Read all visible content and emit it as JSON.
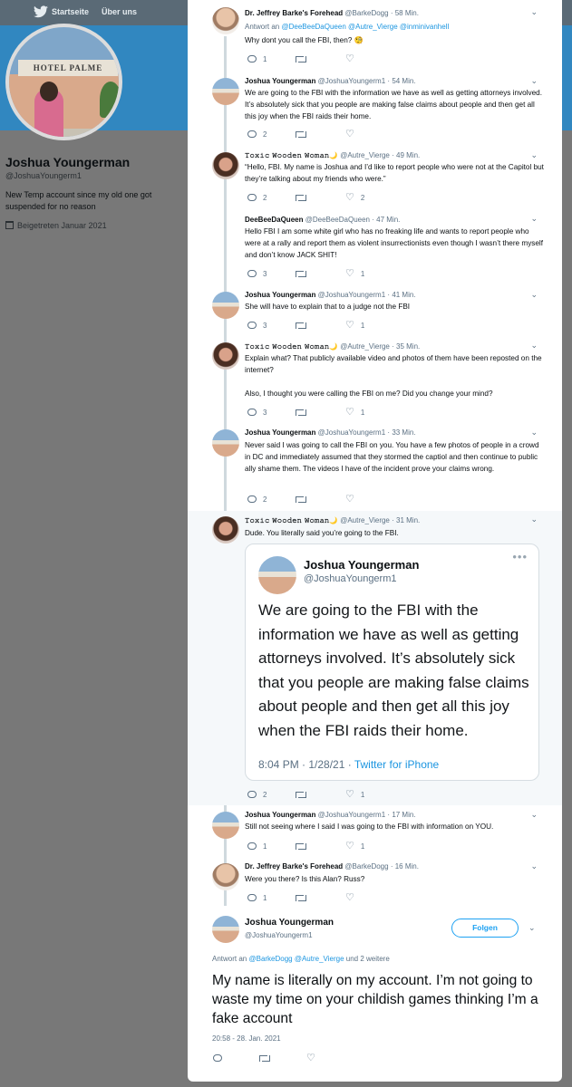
{
  "topbar": {
    "home": "Startseite",
    "about": "Über uns"
  },
  "profile": {
    "name": "Joshua Youngerman",
    "handle": "@JoshuaYoungerm1",
    "bio": "New Temp account since my old one got suspended for no reason",
    "joined": "Beigetreten Januar 2021",
    "avatar_sign": "HOTEL PALME"
  },
  "tweets": [
    {
      "author": "Dr. Jeffrey Barke's Forehead",
      "handle": "@BarkeDogg",
      "time": "58 Min.",
      "reply_prefix": "Antwort an",
      "reply_to": "@DeeBeeDaQueen @Autre_Vierge @inminivanhell",
      "text": "Why dont you call the FBI, then? 🧐",
      "replies": "1",
      "retweets": "",
      "likes": ""
    },
    {
      "author": "Joshua Youngerman",
      "handle": "@JoshuaYoungerm1",
      "time": "54 Min.",
      "text": "We are going to the FBI with the information we have as well as getting attorneys involved. It’s absolutely sick that you people are making false claims about people and then get all this joy when the FBI raids their home.",
      "replies": "2",
      "retweets": "",
      "likes": ""
    },
    {
      "author": "𝚃𝚘𝚡𝚒𝚌 𝚆𝚘𝚘𝚍𝚎𝚗 𝚆𝚘𝚖𝚊𝚗🌙",
      "handle": "@Autre_Vierge",
      "time": "49 Min.",
      "text": "“Hello, FBI. My name is Joshua and I’d like to report people who were not at the Capitol but they’re talking about my friends who were.”",
      "replies": "2",
      "retweets": "",
      "likes": "2"
    },
    {
      "author": "DeeBeeDaQueen",
      "handle": "@DeeBeeDaQueen",
      "time": "47 Min.",
      "text": "Hello FBI I am some white girl who has no freaking life and wants to report people who were at a rally and report them as violent insurrectionists even though I wasn’t there myself and don’t know JACK SHIT!",
      "replies": "3",
      "retweets": "",
      "likes": "1"
    },
    {
      "author": "Joshua Youngerman",
      "handle": "@JoshuaYoungerm1",
      "time": "41 Min.",
      "text": "She will have to explain that to a judge not the FBI",
      "replies": "3",
      "retweets": "",
      "likes": "1"
    },
    {
      "author": "𝚃𝚘𝚡𝚒𝚌 𝚆𝚘𝚘𝚍𝚎𝚗 𝚆𝚘𝚖𝚊𝚗🌙",
      "handle": "@Autre_Vierge",
      "time": "35 Min.",
      "text": "Explain what? That publicly available video and photos of them have been reposted on the internet?\n\nAlso, I thought you were calling the FBI on me? Did you change your mind?",
      "replies": "3",
      "retweets": "",
      "likes": "1"
    },
    {
      "author": "Joshua Youngerman",
      "handle": "@JoshuaYoungerm1",
      "time": "33 Min.",
      "text": "Never said I was going to call the FBI on you. You have a few photos of people in a crowd in DC and immediately assumed that they stormed the captiol and then continue to public ally shame them. The videos I have of the incident prove your claims wrong.",
      "replies": "2",
      "retweets": "",
      "likes": ""
    },
    {
      "author": "𝚃𝚘𝚡𝚒𝚌 𝚆𝚘𝚘𝚍𝚎𝚗 𝚆𝚘𝚖𝚊𝚗🌙",
      "handle": "@Autre_Vierge",
      "time": "31 Min.",
      "text": "Dude. You literally said you’re going to the FBI.",
      "replies": "2",
      "retweets": "",
      "likes": "1",
      "quote": {
        "name": "Joshua Youngerman",
        "handle": "@JoshuaYoungerm1",
        "more": "•••",
        "text": "We are going to the FBI with the information we have as well as getting attorneys involved. It’s absolutely sick that you people are making false claims about people and then get all this joy when the FBI raids their home.",
        "meta_time": "8:04 PM · 1/28/21 · ",
        "meta_source": "Twitter for iPhone"
      }
    },
    {
      "author": "Joshua Youngerman",
      "handle": "@JoshuaYoungerm1",
      "time": "17 Min.",
      "text": "Still not seeing where I said I was going to the FBI with information on YOU.",
      "replies": "1",
      "retweets": "",
      "likes": "1"
    },
    {
      "author": "Dr. Jeffrey Barke's Forehead",
      "handle": "@BarkeDogg",
      "time": "16 Min.",
      "text": "Were you there? Is this Alan? Russ?",
      "replies": "1",
      "retweets": "",
      "likes": ""
    }
  ],
  "main": {
    "name": "Joshua Youngerman",
    "handle": "@JoshuaYoungerm1",
    "follow": "Folgen",
    "reply_prefix": "Antwort an",
    "reply_to": "@BarkeDogg @Autre_Vierge",
    "reply_suffix": " und 2 weitere",
    "text": "My name is literally on my account. I’m not going to waste my time on your childish games thinking I’m a fake account",
    "meta": "20:58 - 28. Jan. 2021"
  },
  "dot": "·",
  "chevron": "⌄"
}
